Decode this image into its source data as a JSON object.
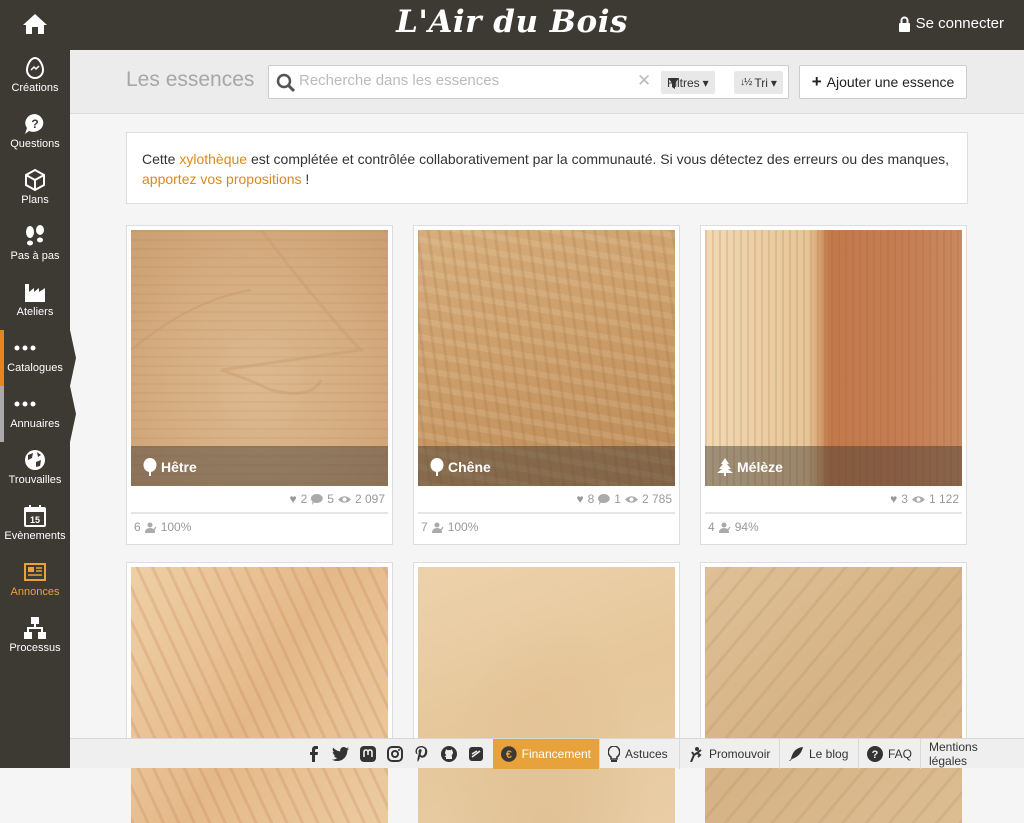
{
  "brand": "L'Air du Bois",
  "login": {
    "label": "Se connecter"
  },
  "sidebar": {
    "items": [
      {
        "label": "Créations"
      },
      {
        "label": "Questions"
      },
      {
        "label": "Plans"
      },
      {
        "label": "Pas à pas"
      },
      {
        "label": "Ateliers"
      },
      {
        "label": "Catalogues"
      },
      {
        "label": "Annuaires"
      },
      {
        "label": "Trouvailles"
      },
      {
        "label": "Evènements"
      },
      {
        "label": "Annonces"
      },
      {
        "label": "Processus"
      }
    ],
    "calendar_day": "15"
  },
  "header": {
    "title": "Les essences",
    "search_placeholder": "Recherche dans les essences",
    "filters_label": "Filtres",
    "sort_label": "Tri",
    "add_label": "Ajouter une essence"
  },
  "notice": {
    "p1": "Cette ",
    "link1": "xylothèque",
    "p2": " est complétée et contrôlée collaborativement par la communauté. Si vous détectez des erreurs ou des manques, ",
    "link2": "apportez vos propositions",
    "p3": " !"
  },
  "cards": [
    {
      "name": "Hêtre",
      "likes": "2",
      "comments": "5",
      "views": "2 097",
      "contributors": "6",
      "completion": "100%"
    },
    {
      "name": "Chêne",
      "likes": "8",
      "comments": "1",
      "views": "2 785",
      "contributors": "7",
      "completion": "100%"
    },
    {
      "name": "Mélèze",
      "likes": "3",
      "views": "1 122",
      "contributors": "4",
      "completion": "94%"
    }
  ],
  "footer": {
    "financement": "Financement",
    "astuces": "Astuces",
    "promouvoir": "Promouvoir",
    "blog": "Le blog",
    "faq": "FAQ",
    "mentions": "Mentions légales"
  },
  "colors": {
    "accent": "#e8a23c",
    "bar": "#3d3933",
    "link": "#d98a1e"
  }
}
